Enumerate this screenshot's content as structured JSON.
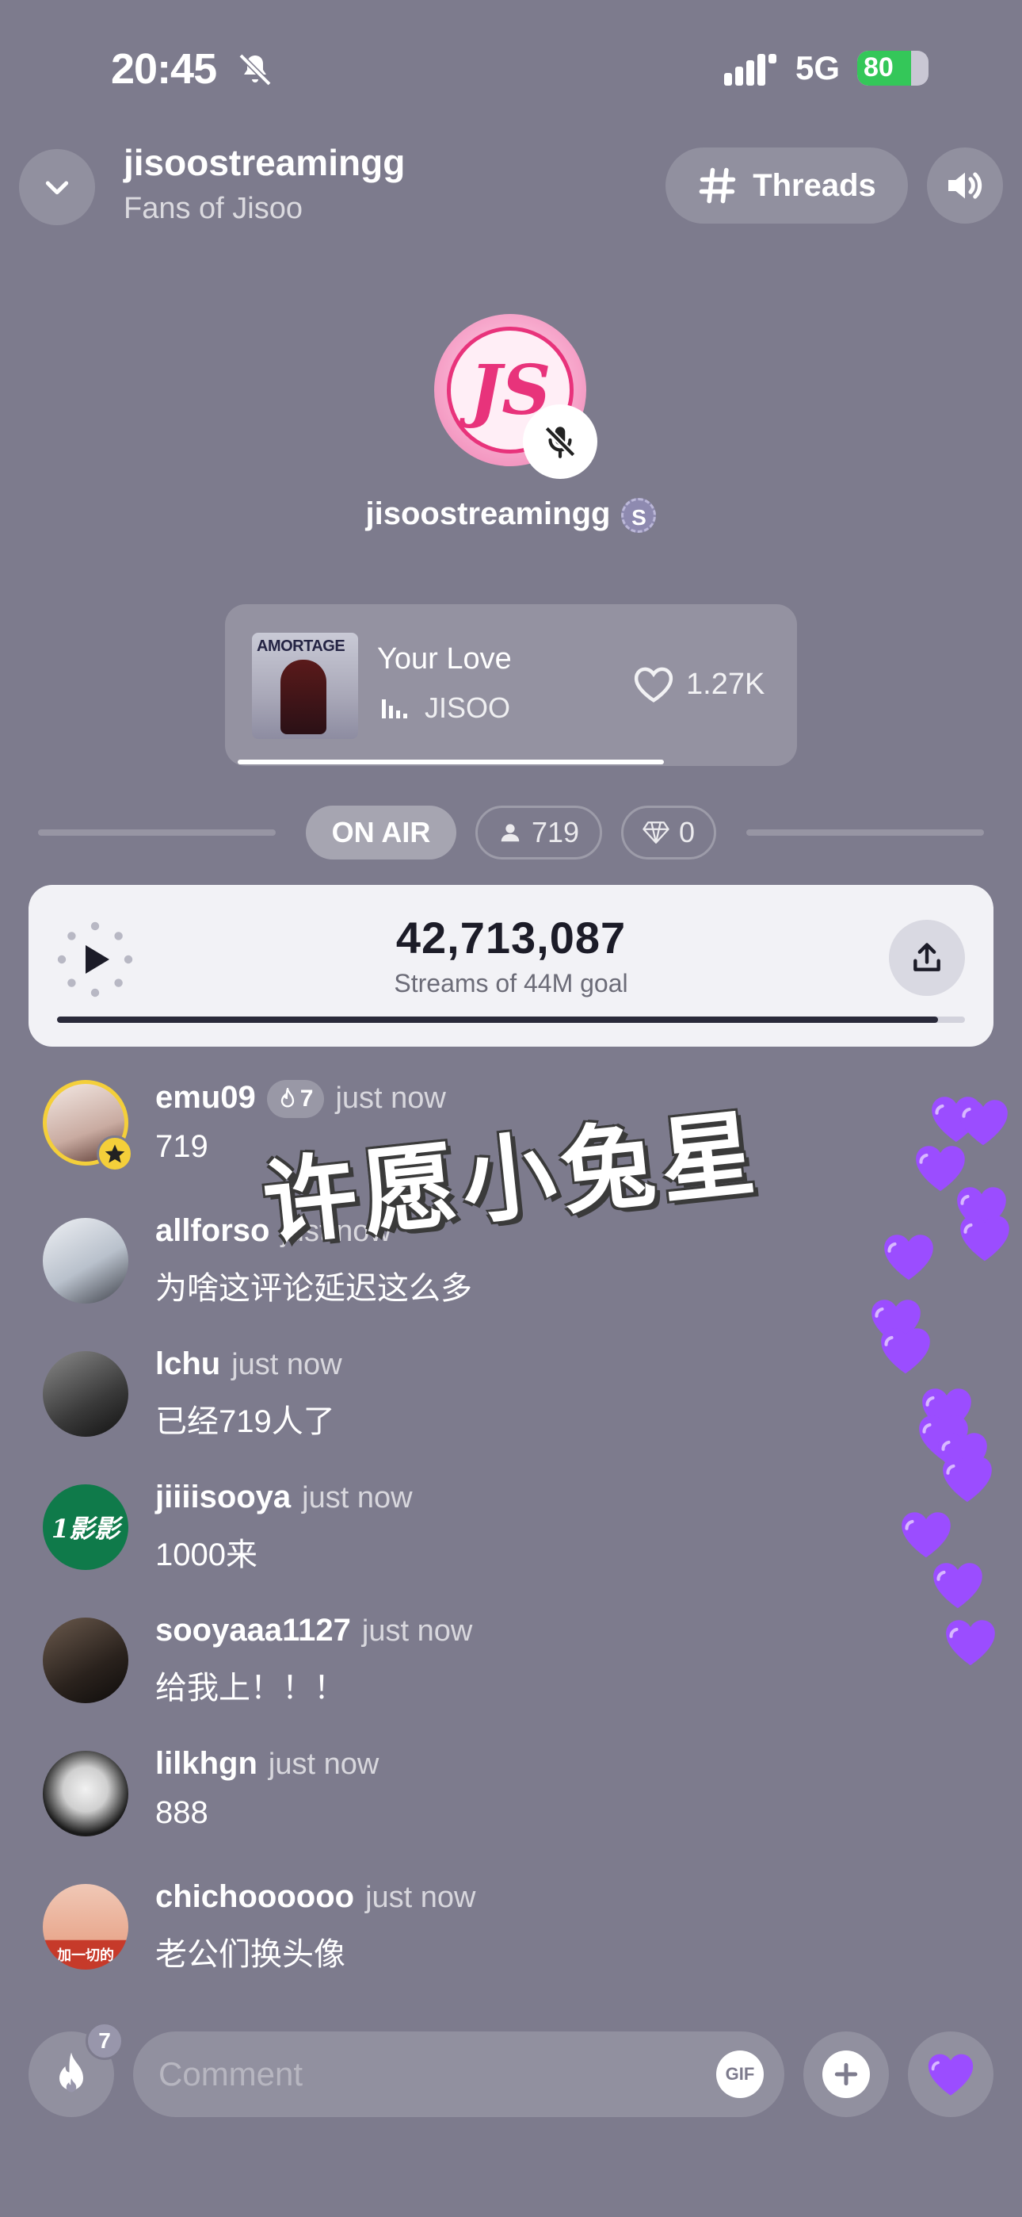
{
  "status_bar": {
    "time": "20:45",
    "network": "5G",
    "battery": "80"
  },
  "header": {
    "room_name": "jisoostreamingg",
    "subtitle": "Fans of Jisoo",
    "threads_label": "Threads"
  },
  "host": {
    "name": "jisoostreamingg",
    "logo_text": "JS",
    "verified_letter": "S"
  },
  "now_playing": {
    "cover_title": "AMORTAGE",
    "song": "Your Love",
    "artist": "JISOO",
    "likes": "1.27K",
    "progress": 0.78
  },
  "room_stats": {
    "on_air": "ON AIR",
    "listeners": "719",
    "gems": "0"
  },
  "stream_goal": {
    "count": "42,713,087",
    "label": "Streams of 44M goal",
    "progress": 0.97
  },
  "watermark": "许愿小兔星",
  "comments": [
    {
      "user": "emu09",
      "fire": "7",
      "time": "just now",
      "text": "719"
    },
    {
      "user": "allforso",
      "time": "just now",
      "text": "为啥这评论延迟这么多"
    },
    {
      "user": "lchu",
      "time": "just now",
      "text": "已经719人了"
    },
    {
      "user": "jiiiisooya",
      "time": "just now",
      "text": "1000来",
      "avatar_text": "1影影"
    },
    {
      "user": "sooyaaa1127",
      "time": "just now",
      "text": "给我上！！！"
    },
    {
      "user": "lilkhgn",
      "time": "just now",
      "text": "888"
    },
    {
      "user": "chichoooooo",
      "time": "just now",
      "text": "老公们换头像",
      "avatar_text": "加一切的"
    }
  ],
  "composer": {
    "placeholder": "Comment",
    "gif_label": "GIF",
    "fire_count": "7"
  },
  "colors": {
    "background": "#7d7b8d",
    "accent_purple": "#9b4dff",
    "battery_green": "#34c759"
  }
}
